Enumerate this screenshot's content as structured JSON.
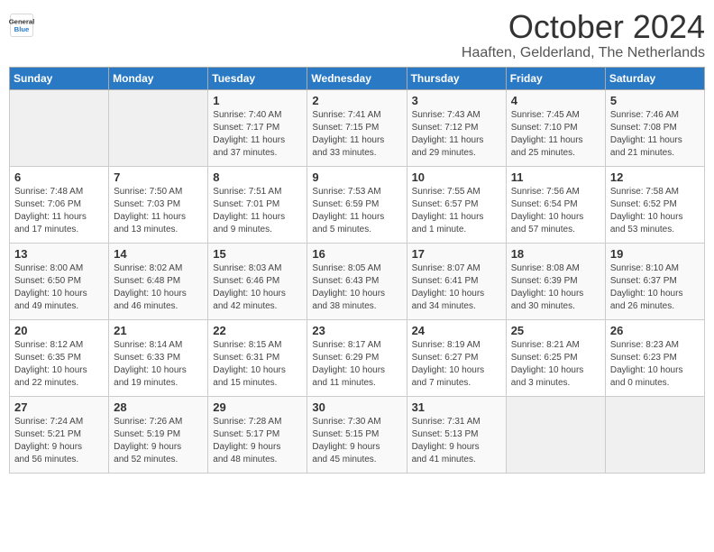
{
  "logo": {
    "line1": "General",
    "line2": "Blue"
  },
  "title": "October 2024",
  "location": "Haaften, Gelderland, The Netherlands",
  "days_header": [
    "Sunday",
    "Monday",
    "Tuesday",
    "Wednesday",
    "Thursday",
    "Friday",
    "Saturday"
  ],
  "weeks": [
    [
      {
        "num": "",
        "info": ""
      },
      {
        "num": "",
        "info": ""
      },
      {
        "num": "1",
        "info": "Sunrise: 7:40 AM\nSunset: 7:17 PM\nDaylight: 11 hours\nand 37 minutes."
      },
      {
        "num": "2",
        "info": "Sunrise: 7:41 AM\nSunset: 7:15 PM\nDaylight: 11 hours\nand 33 minutes."
      },
      {
        "num": "3",
        "info": "Sunrise: 7:43 AM\nSunset: 7:12 PM\nDaylight: 11 hours\nand 29 minutes."
      },
      {
        "num": "4",
        "info": "Sunrise: 7:45 AM\nSunset: 7:10 PM\nDaylight: 11 hours\nand 25 minutes."
      },
      {
        "num": "5",
        "info": "Sunrise: 7:46 AM\nSunset: 7:08 PM\nDaylight: 11 hours\nand 21 minutes."
      }
    ],
    [
      {
        "num": "6",
        "info": "Sunrise: 7:48 AM\nSunset: 7:06 PM\nDaylight: 11 hours\nand 17 minutes."
      },
      {
        "num": "7",
        "info": "Sunrise: 7:50 AM\nSunset: 7:03 PM\nDaylight: 11 hours\nand 13 minutes."
      },
      {
        "num": "8",
        "info": "Sunrise: 7:51 AM\nSunset: 7:01 PM\nDaylight: 11 hours\nand 9 minutes."
      },
      {
        "num": "9",
        "info": "Sunrise: 7:53 AM\nSunset: 6:59 PM\nDaylight: 11 hours\nand 5 minutes."
      },
      {
        "num": "10",
        "info": "Sunrise: 7:55 AM\nSunset: 6:57 PM\nDaylight: 11 hours\nand 1 minute."
      },
      {
        "num": "11",
        "info": "Sunrise: 7:56 AM\nSunset: 6:54 PM\nDaylight: 10 hours\nand 57 minutes."
      },
      {
        "num": "12",
        "info": "Sunrise: 7:58 AM\nSunset: 6:52 PM\nDaylight: 10 hours\nand 53 minutes."
      }
    ],
    [
      {
        "num": "13",
        "info": "Sunrise: 8:00 AM\nSunset: 6:50 PM\nDaylight: 10 hours\nand 49 minutes."
      },
      {
        "num": "14",
        "info": "Sunrise: 8:02 AM\nSunset: 6:48 PM\nDaylight: 10 hours\nand 46 minutes."
      },
      {
        "num": "15",
        "info": "Sunrise: 8:03 AM\nSunset: 6:46 PM\nDaylight: 10 hours\nand 42 minutes."
      },
      {
        "num": "16",
        "info": "Sunrise: 8:05 AM\nSunset: 6:43 PM\nDaylight: 10 hours\nand 38 minutes."
      },
      {
        "num": "17",
        "info": "Sunrise: 8:07 AM\nSunset: 6:41 PM\nDaylight: 10 hours\nand 34 minutes."
      },
      {
        "num": "18",
        "info": "Sunrise: 8:08 AM\nSunset: 6:39 PM\nDaylight: 10 hours\nand 30 minutes."
      },
      {
        "num": "19",
        "info": "Sunrise: 8:10 AM\nSunset: 6:37 PM\nDaylight: 10 hours\nand 26 minutes."
      }
    ],
    [
      {
        "num": "20",
        "info": "Sunrise: 8:12 AM\nSunset: 6:35 PM\nDaylight: 10 hours\nand 22 minutes."
      },
      {
        "num": "21",
        "info": "Sunrise: 8:14 AM\nSunset: 6:33 PM\nDaylight: 10 hours\nand 19 minutes."
      },
      {
        "num": "22",
        "info": "Sunrise: 8:15 AM\nSunset: 6:31 PM\nDaylight: 10 hours\nand 15 minutes."
      },
      {
        "num": "23",
        "info": "Sunrise: 8:17 AM\nSunset: 6:29 PM\nDaylight: 10 hours\nand 11 minutes."
      },
      {
        "num": "24",
        "info": "Sunrise: 8:19 AM\nSunset: 6:27 PM\nDaylight: 10 hours\nand 7 minutes."
      },
      {
        "num": "25",
        "info": "Sunrise: 8:21 AM\nSunset: 6:25 PM\nDaylight: 10 hours\nand 3 minutes."
      },
      {
        "num": "26",
        "info": "Sunrise: 8:23 AM\nSunset: 6:23 PM\nDaylight: 10 hours\nand 0 minutes."
      }
    ],
    [
      {
        "num": "27",
        "info": "Sunrise: 7:24 AM\nSunset: 5:21 PM\nDaylight: 9 hours\nand 56 minutes."
      },
      {
        "num": "28",
        "info": "Sunrise: 7:26 AM\nSunset: 5:19 PM\nDaylight: 9 hours\nand 52 minutes."
      },
      {
        "num": "29",
        "info": "Sunrise: 7:28 AM\nSunset: 5:17 PM\nDaylight: 9 hours\nand 48 minutes."
      },
      {
        "num": "30",
        "info": "Sunrise: 7:30 AM\nSunset: 5:15 PM\nDaylight: 9 hours\nand 45 minutes."
      },
      {
        "num": "31",
        "info": "Sunrise: 7:31 AM\nSunset: 5:13 PM\nDaylight: 9 hours\nand 41 minutes."
      },
      {
        "num": "",
        "info": ""
      },
      {
        "num": "",
        "info": ""
      }
    ]
  ]
}
